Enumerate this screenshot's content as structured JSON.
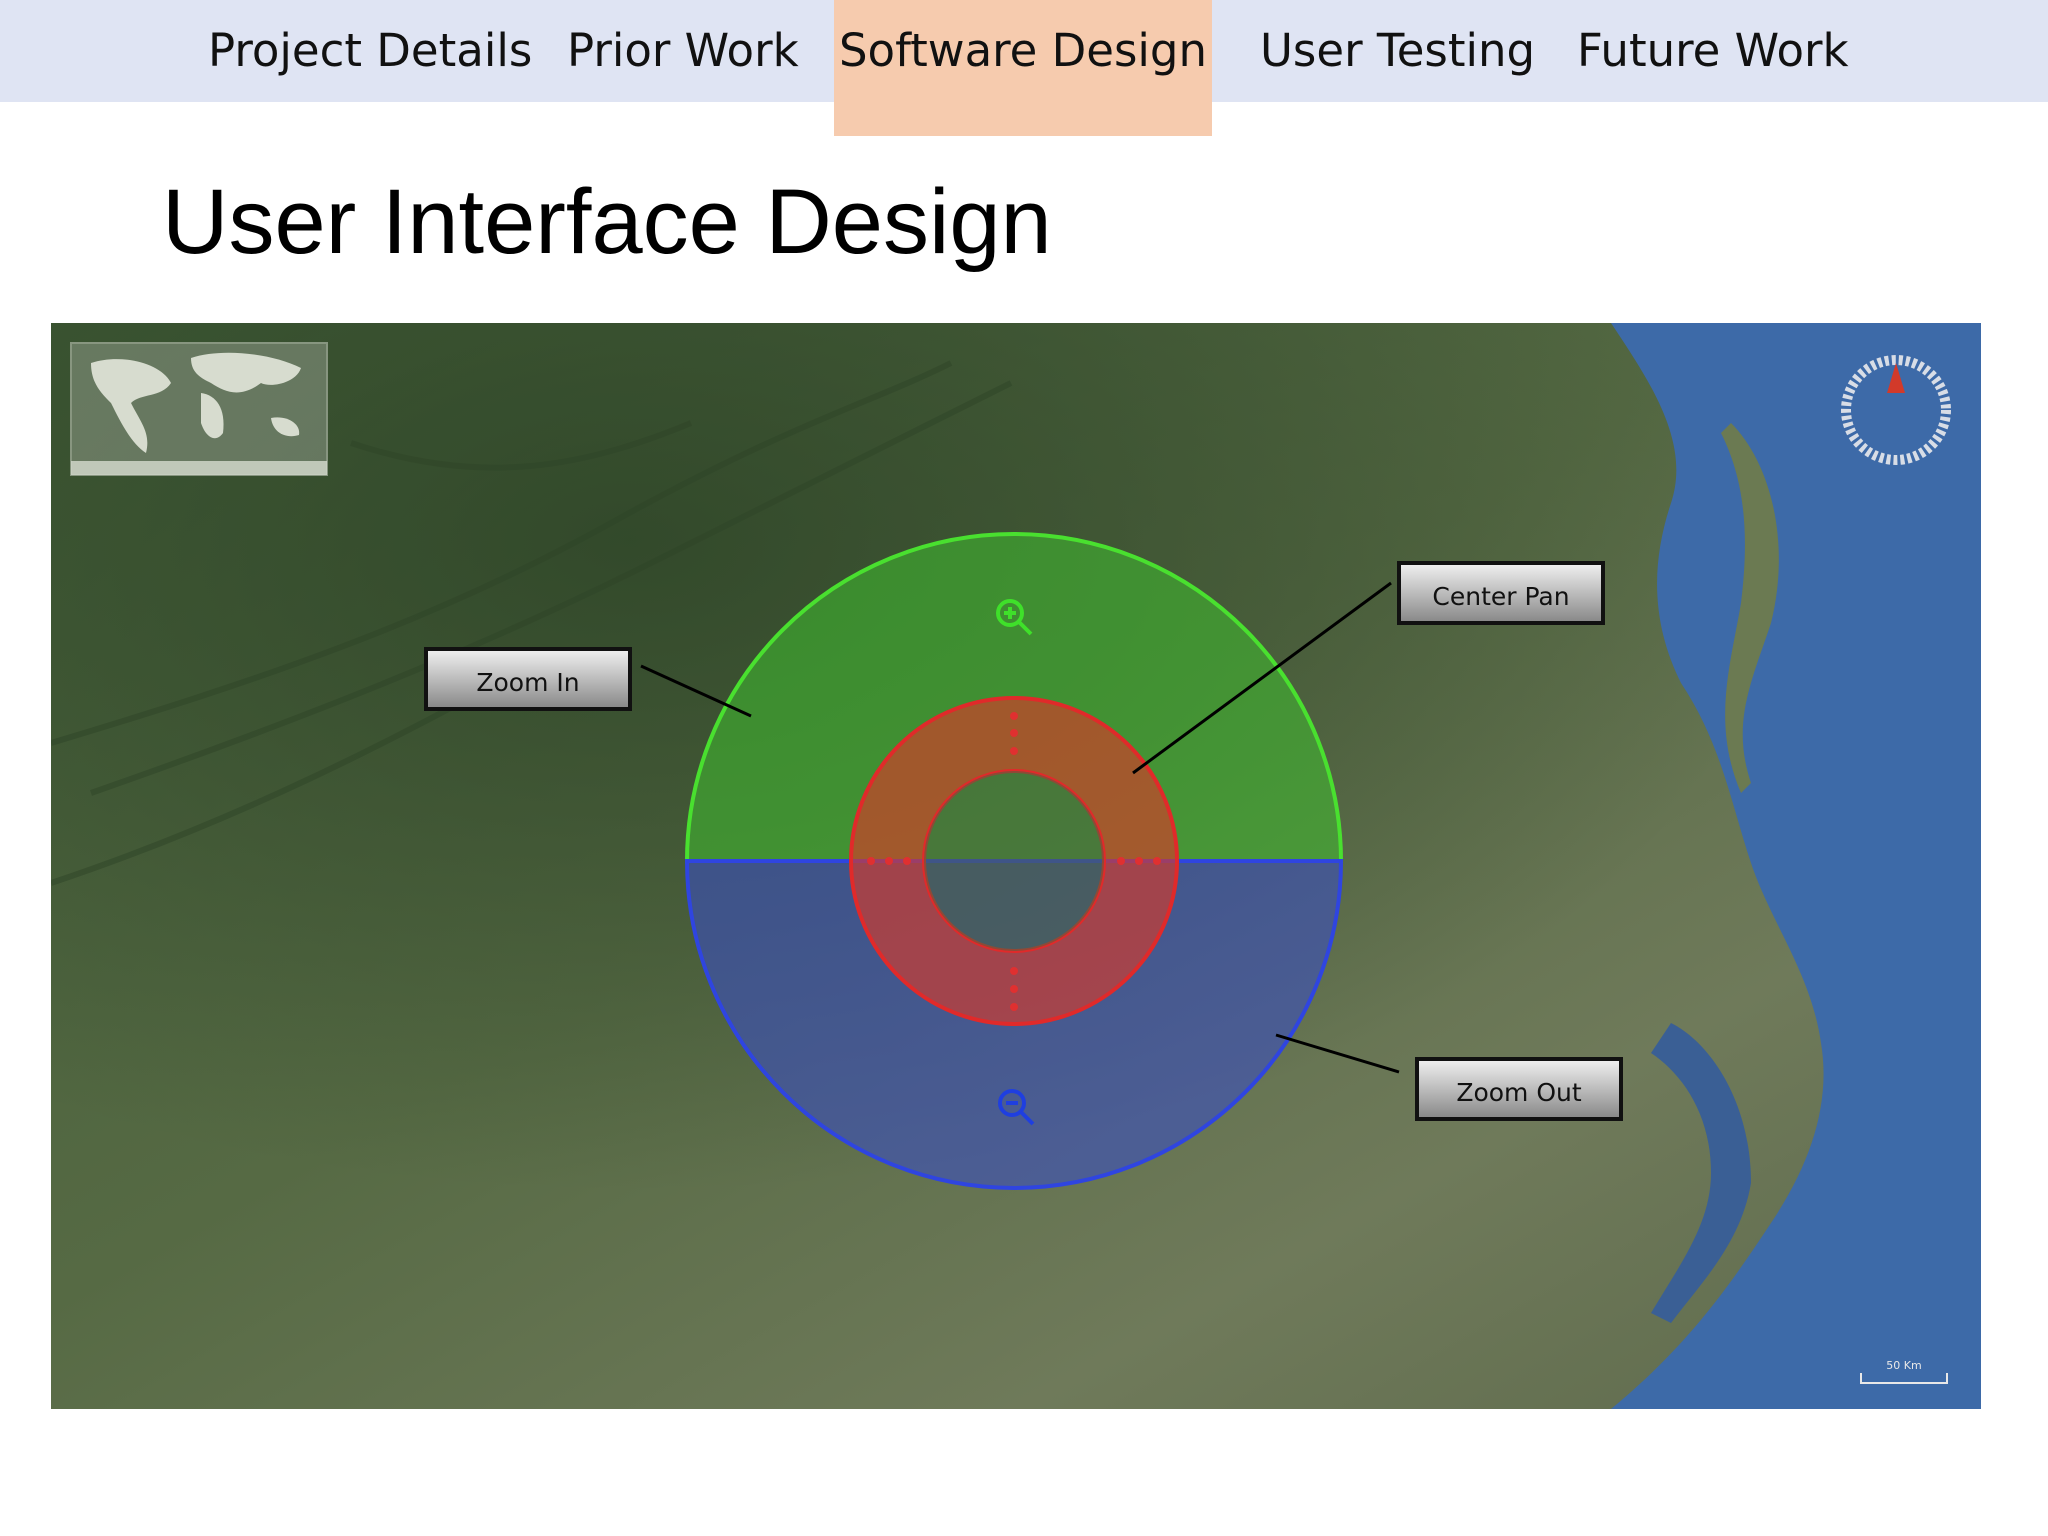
{
  "nav": {
    "tabs": [
      {
        "label": "Project Details"
      },
      {
        "label": "Prior Work"
      },
      {
        "label": "Software Design",
        "active": true
      },
      {
        "label": "User Testing"
      },
      {
        "label": "Future Work"
      }
    ],
    "colors": {
      "bar": "#dfe4f3",
      "active": "#f6cbae"
    }
  },
  "title": "User Interface Design",
  "diagram": {
    "callouts": {
      "zoom_in": "Zoom In",
      "center_pan": "Center Pan",
      "zoom_out": "Zoom Out"
    },
    "colors": {
      "zoom_in_region": "#3fbf2f",
      "zoom_out_region": "#3a4fc0",
      "pan_ring": "#d63a2a"
    },
    "icons": {
      "zoom_in": "zoom-in-magnifier-icon",
      "zoom_out": "zoom-out-magnifier-icon",
      "compass": "compass-icon",
      "world_map": "world-minimap-icon"
    },
    "scale_label": "50 Km"
  }
}
